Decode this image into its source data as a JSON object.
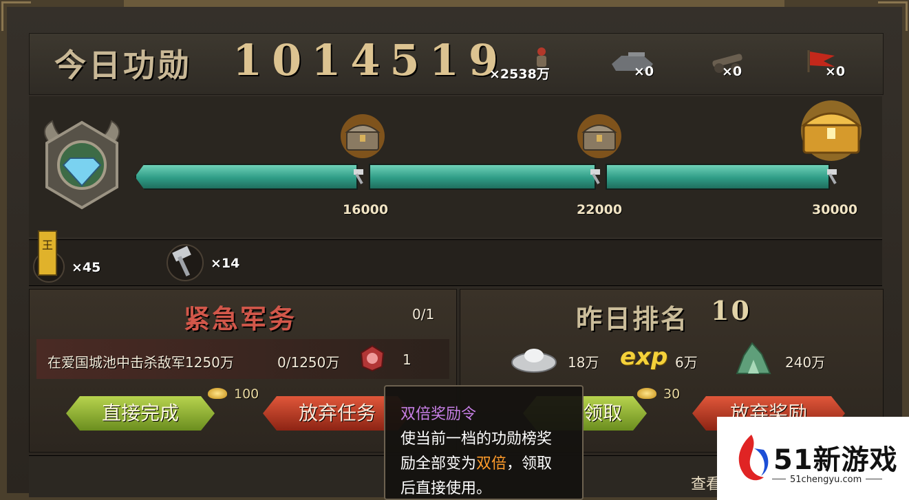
{
  "header": {
    "title": "今日功勋",
    "merit_value": "1014519",
    "resources": [
      {
        "icon": "soldier-icon",
        "count": "×2538万"
      },
      {
        "icon": "tank-icon",
        "count": "×0"
      },
      {
        "icon": "cannon-icon",
        "count": "×0"
      },
      {
        "icon": "flag-icon",
        "count": "×0"
      }
    ]
  },
  "progress": {
    "milestones": [
      "16000",
      "22000",
      "30000"
    ],
    "chest_icons": [
      "small-chest-icon",
      "small-chest-icon",
      "gold-chest-icon"
    ],
    "badge_icon": "diamond-rank-badge-icon"
  },
  "inventory": [
    {
      "icon": "king-banner-icon",
      "count": "×45"
    },
    {
      "icon": "hammer-icon",
      "count": "×14"
    }
  ],
  "urgent": {
    "title": "紧急军务",
    "progress": "0/1",
    "task_text": "在爱国城池中击杀敌军1250万",
    "task_progress": "0/1250万",
    "reward_icon": "double-reward-token-icon",
    "reward_count": "1",
    "cost": "100",
    "complete_label": "直接完成",
    "abandon_label": "放弃任务"
  },
  "rank": {
    "title": "昨日排名",
    "rank_value": "10",
    "rewards": [
      {
        "icon": "silver-ingot-icon",
        "value": "18万"
      },
      {
        "icon": "exp-icon",
        "label": "exp",
        "value": "6万"
      },
      {
        "icon": "jade-ore-icon",
        "value": "240万"
      }
    ],
    "cost": "30",
    "claim_label": "领取",
    "abandon_label": "放弃奖励"
  },
  "bottom": {
    "view_label": "查看"
  },
  "tooltip": {
    "title": "双倍奖励令",
    "line1": "使当前一档的功勋榜奖",
    "line2_pre": "励全部变为",
    "line2_hl": "双倍",
    "line2_post": "，领取",
    "line3": "后直接使用。"
  },
  "watermark": {
    "brand": "51新游戏",
    "url": "51chengyu.com"
  },
  "colors": {
    "bar": "#2f9c86",
    "gold_text": "#dcc391",
    "tooltip_title": "#c77fe6",
    "tooltip_highlight": "#ff9b2a"
  }
}
